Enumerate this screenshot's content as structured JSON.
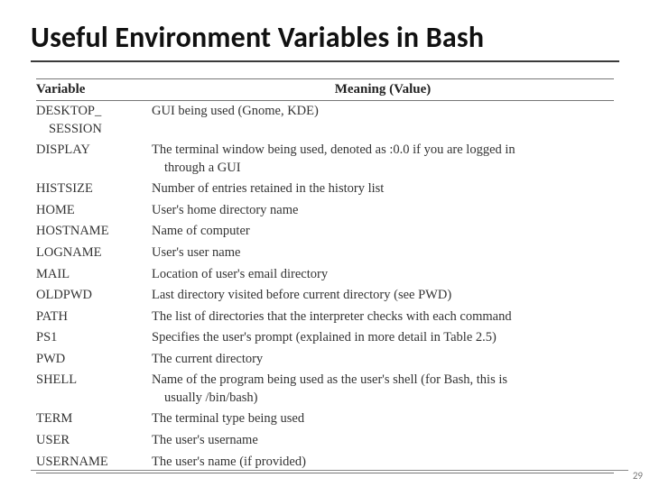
{
  "title": "Useful Environment Variables in Bash",
  "page_number": "29",
  "table": {
    "header_variable": "Variable",
    "header_meaning": "Meaning (Value)",
    "rows": [
      {
        "var_line1": "DESKTOP_",
        "var_line2": "SESSION",
        "meaning_line1": "GUI being used (Gnome, KDE)",
        "meaning_line2": ""
      },
      {
        "var_line1": "DISPLAY",
        "var_line2": "",
        "meaning_line1": "The terminal window being used, denoted as :0.0 if you are logged in",
        "meaning_line2": "through a GUI"
      },
      {
        "var_line1": "HISTSIZE",
        "var_line2": "",
        "meaning_line1": "Number of entries retained in the history list",
        "meaning_line2": ""
      },
      {
        "var_line1": "HOME",
        "var_line2": "",
        "meaning_line1": "User's home directory name",
        "meaning_line2": ""
      },
      {
        "var_line1": "HOSTNAME",
        "var_line2": "",
        "meaning_line1": "Name of computer",
        "meaning_line2": ""
      },
      {
        "var_line1": "LOGNAME",
        "var_line2": "",
        "meaning_line1": "User's user name",
        "meaning_line2": ""
      },
      {
        "var_line1": "MAIL",
        "var_line2": "",
        "meaning_line1": "Location of user's email directory",
        "meaning_line2": ""
      },
      {
        "var_line1": "OLDPWD",
        "var_line2": "",
        "meaning_line1": "Last directory visited before current directory (see PWD)",
        "meaning_line2": ""
      },
      {
        "var_line1": "PATH",
        "var_line2": "",
        "meaning_line1": "The list of directories that the interpreter checks with each command",
        "meaning_line2": ""
      },
      {
        "var_line1": "PS1",
        "var_line2": "",
        "meaning_line1": "Specifies the user's prompt (explained in more detail in Table 2.5)",
        "meaning_line2": ""
      },
      {
        "var_line1": "PWD",
        "var_line2": "",
        "meaning_line1": "The current directory",
        "meaning_line2": ""
      },
      {
        "var_line1": "SHELL",
        "var_line2": "",
        "meaning_line1": "Name of the program being used as the user's shell (for Bash, this is",
        "meaning_line2": "usually /bin/bash)"
      },
      {
        "var_line1": "TERM",
        "var_line2": "",
        "meaning_line1": "The terminal type being used",
        "meaning_line2": ""
      },
      {
        "var_line1": "USER",
        "var_line2": "",
        "meaning_line1": "The user's username",
        "meaning_line2": ""
      },
      {
        "var_line1": "USERNAME",
        "var_line2": "",
        "meaning_line1": "The user's name (if provided)",
        "meaning_line2": ""
      }
    ]
  }
}
